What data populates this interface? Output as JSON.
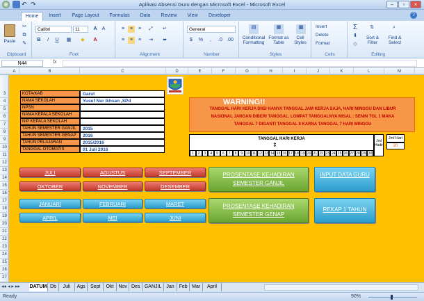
{
  "window": {
    "title": "Aplikasi Absensi Guru dengan Microsoft Excel - Microsoft Excel"
  },
  "ribbon_tabs": [
    "Home",
    "Insert",
    "Page Layout",
    "Formulas",
    "Data",
    "Review",
    "View",
    "Developer"
  ],
  "ribbon": {
    "paste": "Paste",
    "clipboard": "Clipboard",
    "font_name": "Calibri",
    "font_size": "11",
    "font": "Font",
    "alignment": "Alignment",
    "number_format": "General",
    "number": "Number",
    "conditional": "Conditional Formatting",
    "format_table": "Format as Table",
    "cell_styles": "Cell Styles",
    "styles": "Styles",
    "insert": "Insert",
    "delete": "Delete",
    "format": "Format",
    "cells": "Cells",
    "sort": "Sort & Filter",
    "find": "Find & Select",
    "editing": "Editing"
  },
  "name_box": "N44",
  "fx": "fx",
  "columns": [
    "A",
    "B",
    "C",
    "D",
    "E",
    "F",
    "G",
    "H",
    "I",
    "J",
    "K",
    "L",
    "M"
  ],
  "rows": [
    "3",
    "4",
    "5",
    "6",
    "7",
    "8",
    "9",
    "10",
    "11",
    "12",
    "13",
    "14",
    "15",
    "16",
    "17",
    "18",
    "19",
    "20",
    "21",
    "22",
    "23",
    "24",
    "25",
    "26",
    "27"
  ],
  "info": {
    "labels": [
      "KOTA/KAB",
      "NAMA SEKOLAH",
      "NPSN",
      "NAMA KEPALA SEKOLAH",
      "NIP KEPALA SEKOLAH",
      "TAHUN SEMESTER GANJIL",
      "TAHUN SEMESTER GENAP",
      "TAHUN PELAJARAN",
      "TANGGAL OTOMATIS"
    ],
    "values": [
      "Garut",
      "Yusuf Nur Ikhsan ,SPd",
      "",
      "",
      "",
      "2015",
      "2016",
      "2015/2016",
      "01 Juli 2016"
    ]
  },
  "warning": {
    "title": "WARNING!!",
    "line1": "TANGGAL HARI KERJA DIISI HANYA TANGGAL JAM KERJA SAJA, HARI MINGGU DAN LIBUR",
    "line2": "NASIONAL JANGAN DIBERI TANGGAL. LOMPAT TANGGALNYA MISAL : SENIN TGL 1 MAKA",
    "line3": "TANGGAL 7 DIGANTI TANGGAL 8 KARNA TANGGAL 7 HARI MINGGU"
  },
  "day_table": {
    "header": "TANGGAL HARI KERJA",
    "days": [
      "1",
      "2",
      "3",
      "4",
      "5",
      "6",
      "7",
      "8",
      "9",
      "10",
      "11",
      "12",
      "13",
      "14",
      "15",
      "16",
      "17",
      "18",
      "19",
      "20",
      "21",
      "22",
      "23",
      "24",
      "25",
      "26",
      "27",
      "28",
      "29",
      "30"
    ],
    "jml_hadir": "Jml Hadir",
    "jml_hari": "Jml Hari",
    "jml_hari_value": "20"
  },
  "month_buttons": {
    "row1": [
      "JULI",
      "AGUSTUS",
      "SEPTEMBER"
    ],
    "row2": [
      "OKTOBER",
      "NOVEMBER",
      "DESEMBER"
    ],
    "row3": [
      "JANUARI",
      "FEBRUARI",
      "MARET"
    ],
    "row4": [
      "APRIL",
      "MEI",
      "JUNI"
    ]
  },
  "action_buttons": {
    "ganjil": "PROSENTASE KEHADIRAN SEMESTER GANJIL",
    "genap": "PROSENTASE KEHADIRAN SEMESTER GENAP",
    "input": "INPUT DATA GURU",
    "rekap": "REKAP 1 TAHUN"
  },
  "sheet_tabs": [
    "DATUM",
    "Db",
    "Juli",
    "Ags",
    "Sept",
    "Okt",
    "Nov",
    "Des",
    "GANJIL",
    "Jan",
    "Feb",
    "Mar",
    "April"
  ],
  "status": {
    "ready": "Ready",
    "zoom": "90%"
  }
}
